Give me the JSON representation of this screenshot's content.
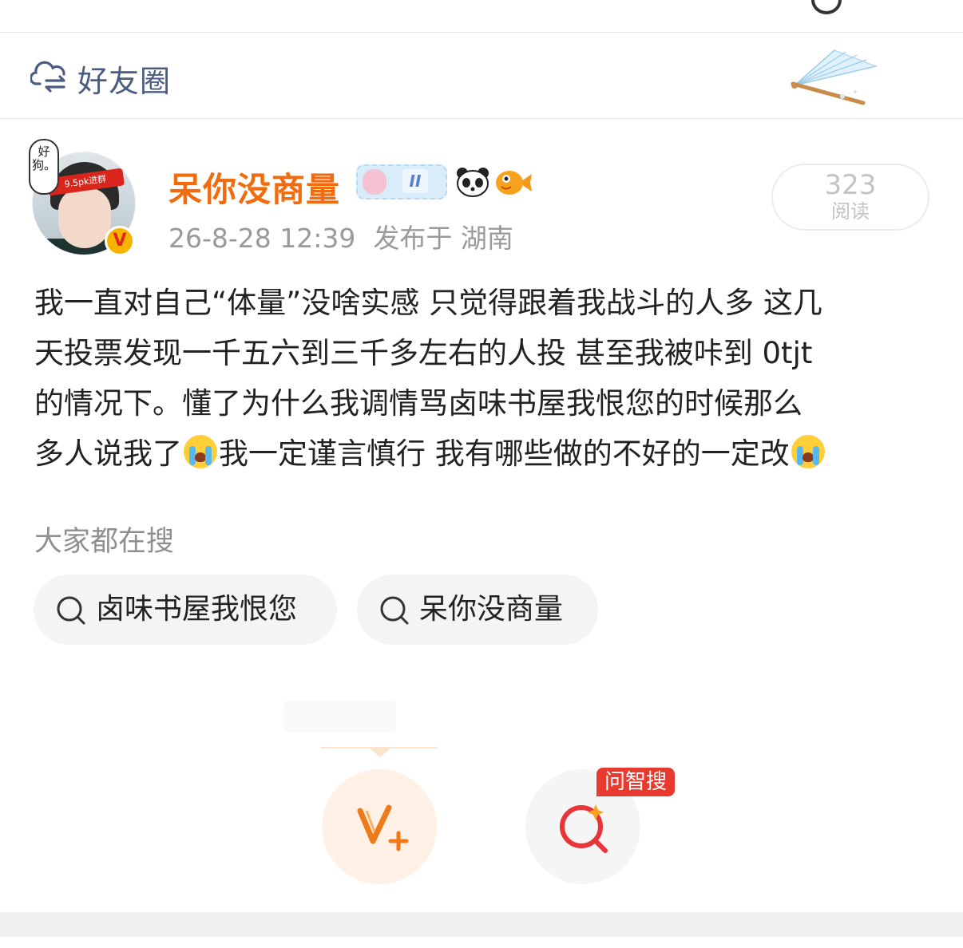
{
  "header": {
    "title": "好友圈",
    "icon": "cloud-sync-icon",
    "decoration": "folding-fan"
  },
  "post": {
    "author": {
      "name": "呆你没商量",
      "avatar_bubble": "好狗。",
      "headband_text": "9.5pk进群",
      "verified_badge": "V",
      "level_badge": "II",
      "emoji_badges": [
        "panda-icon",
        "goldfish-icon"
      ]
    },
    "timestamp": "26-8-28 12:39",
    "location": "发布于 湖南",
    "reads": {
      "count": "323",
      "label": "阅读"
    },
    "lines": [
      "我一直对自己“体量”没啥实感 只觉得跟着我战斗的人多 这几",
      "天投票发现一千五六到三千多左右的人投 甚至我被咔到 0tjt",
      "的情况下。懂了为什么我调情骂卤味书屋我恨您的时候那么",
      "多人说我了",
      "我一定谨言慎行 我有哪些做的不好的一定改"
    ]
  },
  "trending": {
    "label": "大家都在搜",
    "items": [
      "卤味书屋我恨您",
      "呆你没商量"
    ]
  },
  "actions": {
    "ai_tag": "问智搜",
    "compose_icon": "v-plus-icon",
    "search_icon": "ai-search-icon"
  },
  "colors": {
    "username": "#f26b0e",
    "header_title": "#4a5d80",
    "ai_tag_bg": "#e83a2f",
    "fab_v_bg": "#fff1e5"
  }
}
